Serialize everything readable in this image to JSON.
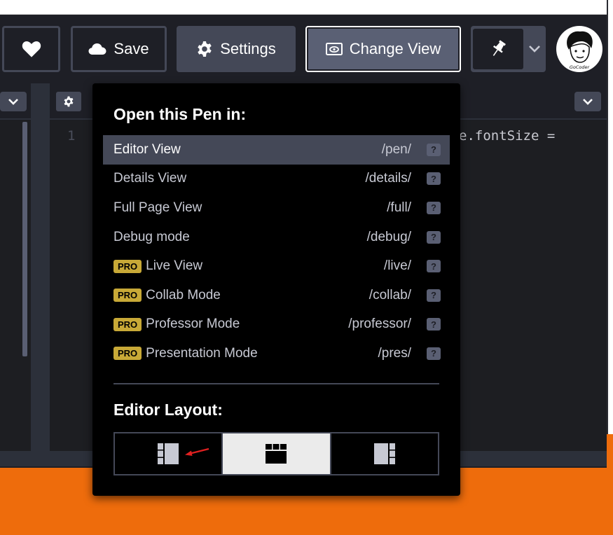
{
  "header": {
    "buttons": {
      "save_label": "Save",
      "settings_label": "Settings",
      "change_view_label": "Change View"
    },
    "avatar_text": "GoCoder"
  },
  "editor": {
    "line_number": "1",
    "code_fragment": "e.fontSize ="
  },
  "dropdown": {
    "title": "Open this Pen in:",
    "items": [
      {
        "label": "Editor View",
        "path": "/pen/",
        "pro": false,
        "active": true
      },
      {
        "label": "Details View",
        "path": "/details/",
        "pro": false
      },
      {
        "label": "Full Page View",
        "path": "/full/",
        "pro": false
      },
      {
        "label": "Debug mode",
        "path": "/debug/",
        "pro": false
      },
      {
        "label": "Live View",
        "path": "/live/",
        "pro": true
      },
      {
        "label": "Collab Mode",
        "path": "/collab/",
        "pro": true
      },
      {
        "label": "Professor Mode",
        "path": "/professor/",
        "pro": true
      },
      {
        "label": "Presentation Mode",
        "path": "/pres/",
        "pro": true
      }
    ],
    "pro_badge": "PRO",
    "help_glyph": "?",
    "layout_title": "Editor Layout:",
    "layouts": [
      "layout-left",
      "layout-top",
      "layout-right"
    ],
    "selected_layout": "layout-top"
  },
  "colors": {
    "accent_orange": "#ee6c0c",
    "pro_badge": "#c8a937",
    "button_bg": "#444857",
    "header_bg": "#1e1f26"
  }
}
